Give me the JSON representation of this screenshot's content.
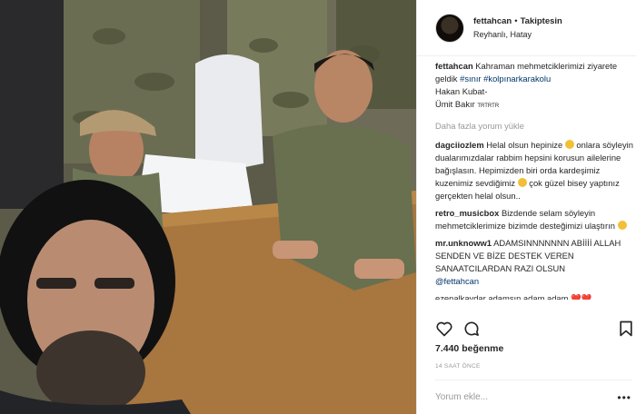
{
  "post": {
    "username": "fettahcan",
    "follow_label": "Takiptesin",
    "separator": "•",
    "location": "Reyhanlı, Hatay"
  },
  "caption": {
    "user": "fettahcan",
    "text1": "Kahraman mehmetciklerimizi ziyarete geldik",
    "tag1": "#sınır",
    "tag2": "#kolpınarkarakolu",
    "line2": "Hakan Kubat-",
    "line3": "Ümit Bakır",
    "tiny": "TRTRTR"
  },
  "load_more": "Daha fazla yorum yükle",
  "comments": [
    {
      "user": "dagciiozlem",
      "text_a": "Helal olsun hepinize",
      "text_b": "onlara söyleyin dualarımızdalar rabbim hepsini korusun ailelerine bağışlasın. Hepimizden biri orda kardeşimiz kuzenimiz sevdiğimiz",
      "text_c": "çok güzel bisey yaptınız gerçekten helal olsun.."
    },
    {
      "user": "retro_musicbox",
      "text_a": "Bizdende selam söyleyin mehmetciklerimize bizimde desteğimizi ulaştırın"
    },
    {
      "user": "mr.unknoww1",
      "text_a": "ADAMSINNNNNNN ABİİİİ ALLAH SENDEN VE BİZE DESTEK VEREN SANAATCILARDAN RAZI OLSUN",
      "mention": "@fettahcan"
    }
  ],
  "cutoff_text": "ezenalkaydar adamsın adam adam ❤️❤️",
  "likes": "7.440 beğenme",
  "time": "14 SAAT ÖNCE",
  "add_comment_placeholder": "Yorum ekle...",
  "more_label": "•••",
  "icons": {
    "like": "heart-icon",
    "comment": "comment-icon",
    "save": "bookmark-icon"
  },
  "colors": {
    "link": "#003569",
    "muted": "#999999",
    "text": "#262626"
  }
}
